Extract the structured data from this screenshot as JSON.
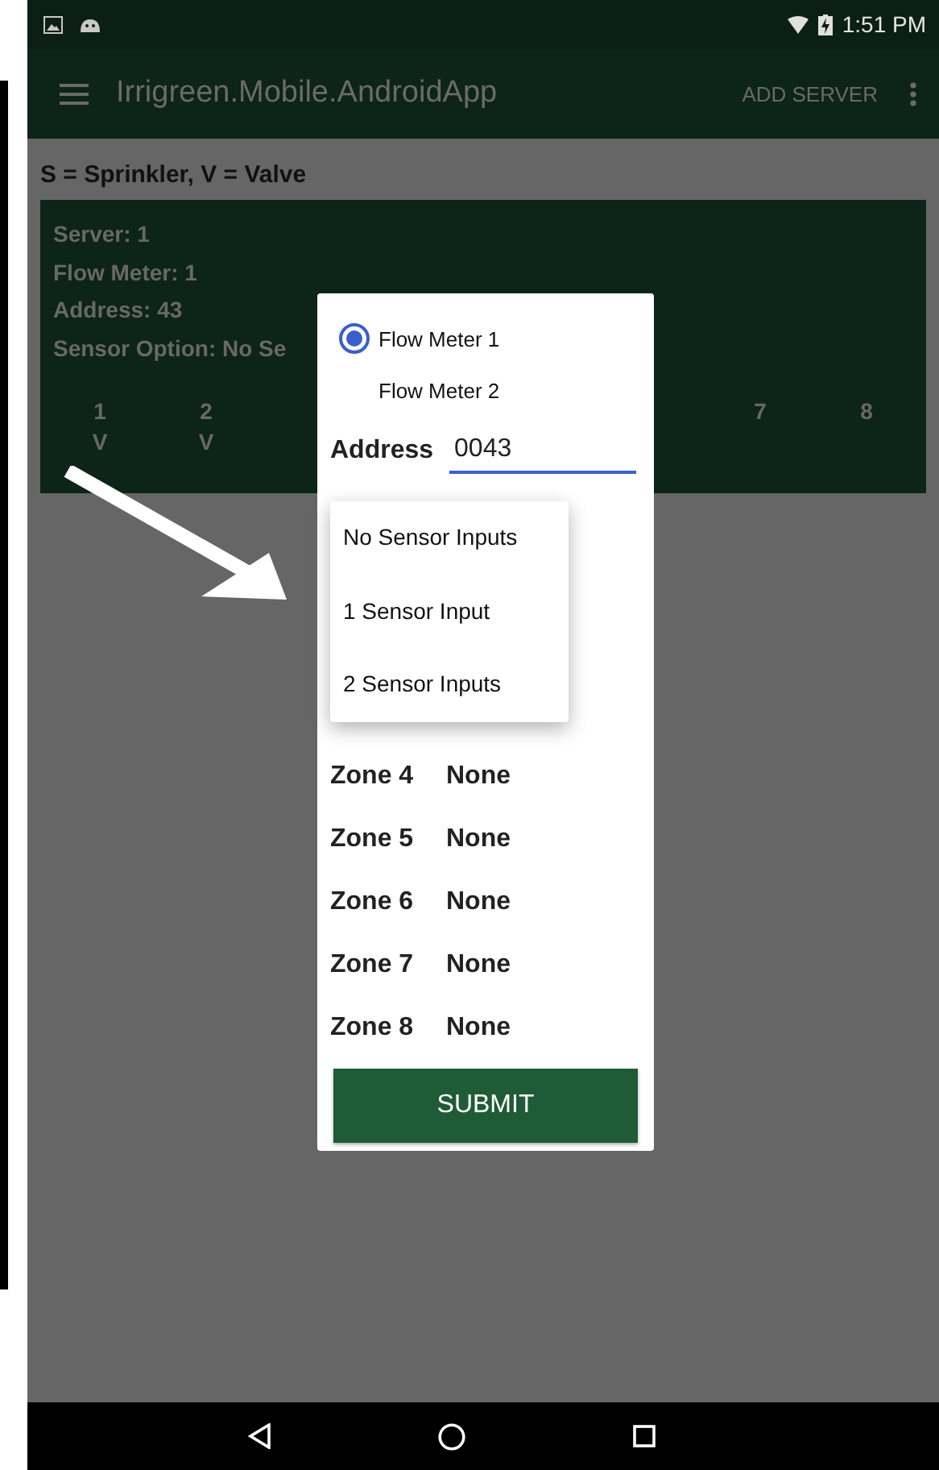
{
  "status_bar": {
    "time": "1:51 PM"
  },
  "toolbar": {
    "title": "Irrigreen.Mobile.AndroidApp",
    "action": "ADD SERVER"
  },
  "legend": "S = Sprinkler, V = Valve",
  "server_card": {
    "lines": [
      "Server: 1",
      "Flow Meter: 1",
      "Address: 43",
      "Sensor Option: No Se"
    ],
    "zones_left": [
      {
        "number": "1",
        "type": "V"
      },
      {
        "number": "2",
        "type": "V"
      }
    ],
    "zones_right": [
      {
        "number": "7"
      },
      {
        "number": "8"
      }
    ]
  },
  "dialog": {
    "flow_meters": [
      {
        "label": "Flow Meter 1",
        "selected": true
      },
      {
        "label": "Flow Meter 2",
        "selected": false
      }
    ],
    "address": {
      "label": "Address",
      "value": "0043"
    },
    "sensor_options": [
      "No Sensor Inputs",
      "1 Sensor Input",
      "2 Sensor Inputs"
    ],
    "zones": [
      {
        "label": "Zone 4",
        "value": "None"
      },
      {
        "label": "Zone 5",
        "value": "None"
      },
      {
        "label": "Zone 6",
        "value": "None"
      },
      {
        "label": "Zone 7",
        "value": "None"
      },
      {
        "label": "Zone 8",
        "value": "None"
      }
    ],
    "submit": "SUBMIT"
  }
}
